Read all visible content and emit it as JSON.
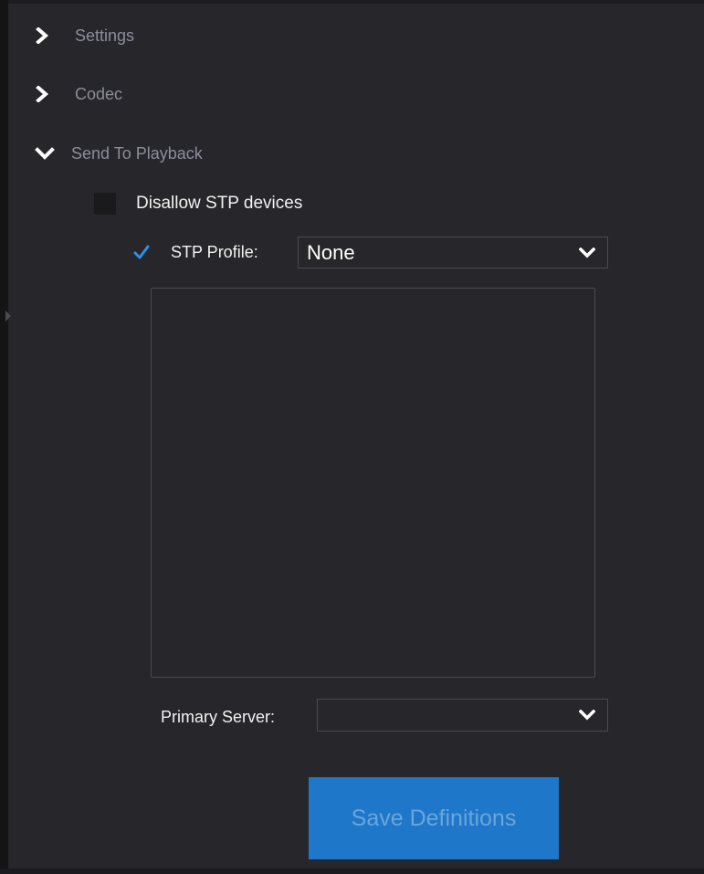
{
  "sections": {
    "settings_label": "Settings",
    "codec_label": "Codec",
    "stp_label": "Send To Playback"
  },
  "stp": {
    "disallow_label": "Disallow STP devices",
    "disallow_checked": false,
    "profile_checked": true,
    "profile_label": "STP Profile:",
    "profile_value": "None",
    "primary_server_label": "Primary Server:",
    "primary_server_value": ""
  },
  "actions": {
    "save_label": "Save Definitions",
    "save_enabled": false
  },
  "icons": {
    "collapsed": "chevron-right-icon",
    "expanded": "chevron-down-icon",
    "check": "checkmark-icon",
    "dropdown": "chevron-down-icon"
  },
  "colors": {
    "background": "#26262b",
    "section_text": "#8c8d99",
    "text": "#f2f2f2",
    "accent": "#1f77c9",
    "check": "#2f8fe6",
    "button_text_disabled": "#6aa5dc"
  }
}
